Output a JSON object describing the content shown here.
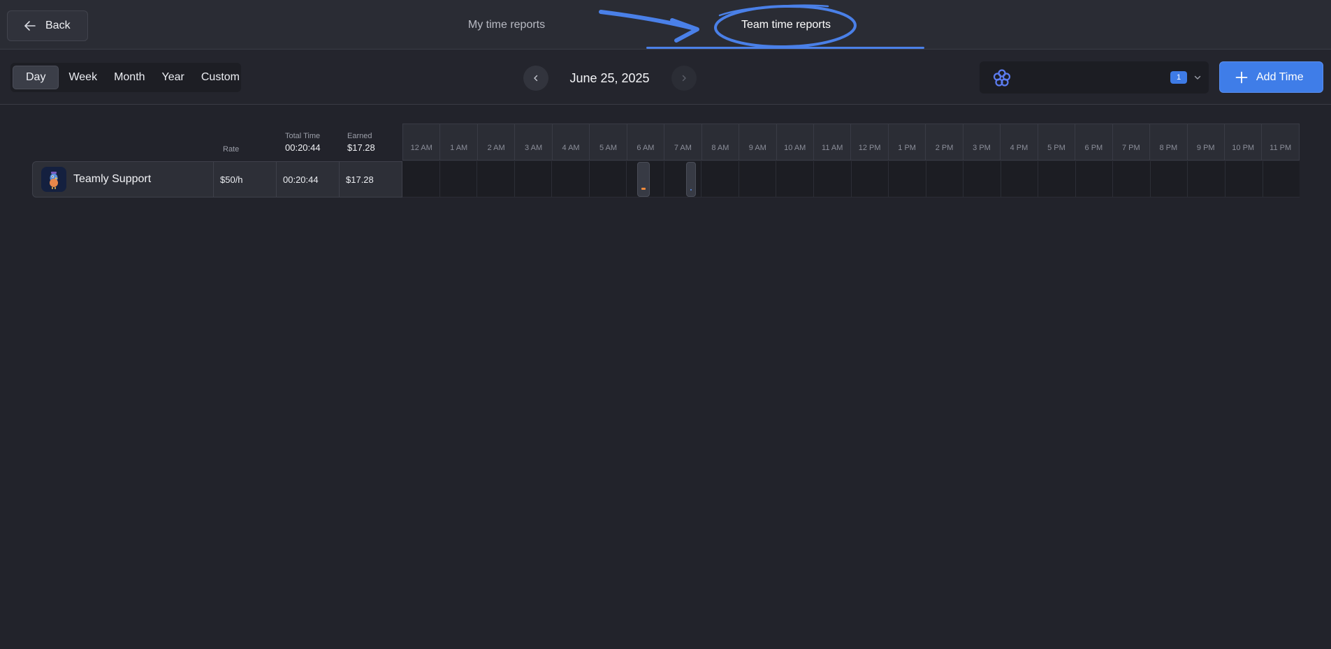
{
  "header": {
    "back_label": "Back",
    "tabs": [
      {
        "label": "My time reports",
        "active": false
      },
      {
        "label": "Team time reports",
        "active": true
      }
    ],
    "accent_color": "#4a80e8"
  },
  "toolbar": {
    "periods": [
      {
        "label": "Day",
        "active": true
      },
      {
        "label": "Week",
        "active": false
      },
      {
        "label": "Month",
        "active": false
      },
      {
        "label": "Year",
        "active": false
      },
      {
        "label": "Custom",
        "active": false
      }
    ],
    "date_label": "June 25, 2025",
    "team_select": {
      "selected_count": "1"
    },
    "add_time_label": "Add Time"
  },
  "table": {
    "columns": {
      "rate": "Rate",
      "total_time": "Total Time",
      "total_time_value": "00:20:44",
      "earned": "Earned",
      "earned_value": "$17.28"
    },
    "hours": [
      "12 AM",
      "1 AM",
      "2 AM",
      "3 AM",
      "4 AM",
      "5 AM",
      "6 AM",
      "7 AM",
      "8 AM",
      "9 AM",
      "10 AM",
      "11 AM",
      "12 PM",
      "1 PM",
      "2 PM",
      "3 PM",
      "4 PM",
      "5 PM",
      "6 PM",
      "7 PM",
      "8 PM",
      "9 PM",
      "10 PM",
      "11 PM"
    ],
    "rows": [
      {
        "name": "Teamly Support",
        "rate": "$50/h",
        "total_time": "00:20:44",
        "earned": "$17.28",
        "activity_hours": [
          "6 AM",
          "7 AM"
        ]
      }
    ]
  }
}
